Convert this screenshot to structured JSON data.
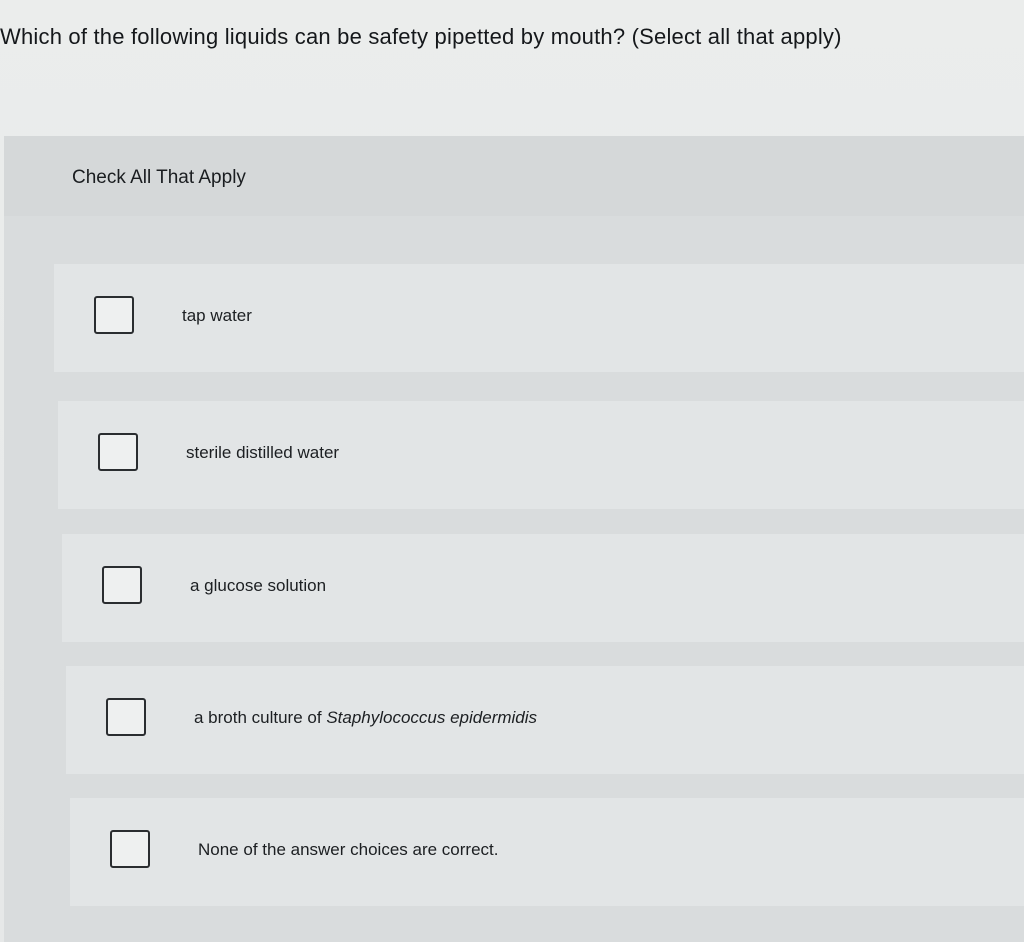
{
  "question": {
    "text": "Which of the following liquids can be safety pipetted by mouth? (Select all that apply)"
  },
  "panel": {
    "title": "Check All That Apply"
  },
  "options": [
    {
      "label": "tap water",
      "checked": false
    },
    {
      "label": "sterile distilled water",
      "checked": false
    },
    {
      "label": "a glucose solution",
      "checked": false
    },
    {
      "label_prefix": "a broth culture of ",
      "label_italic": "Staphylococcus epidermidis",
      "checked": false
    },
    {
      "label": "None of the answer choices are correct.",
      "checked": false
    }
  ]
}
